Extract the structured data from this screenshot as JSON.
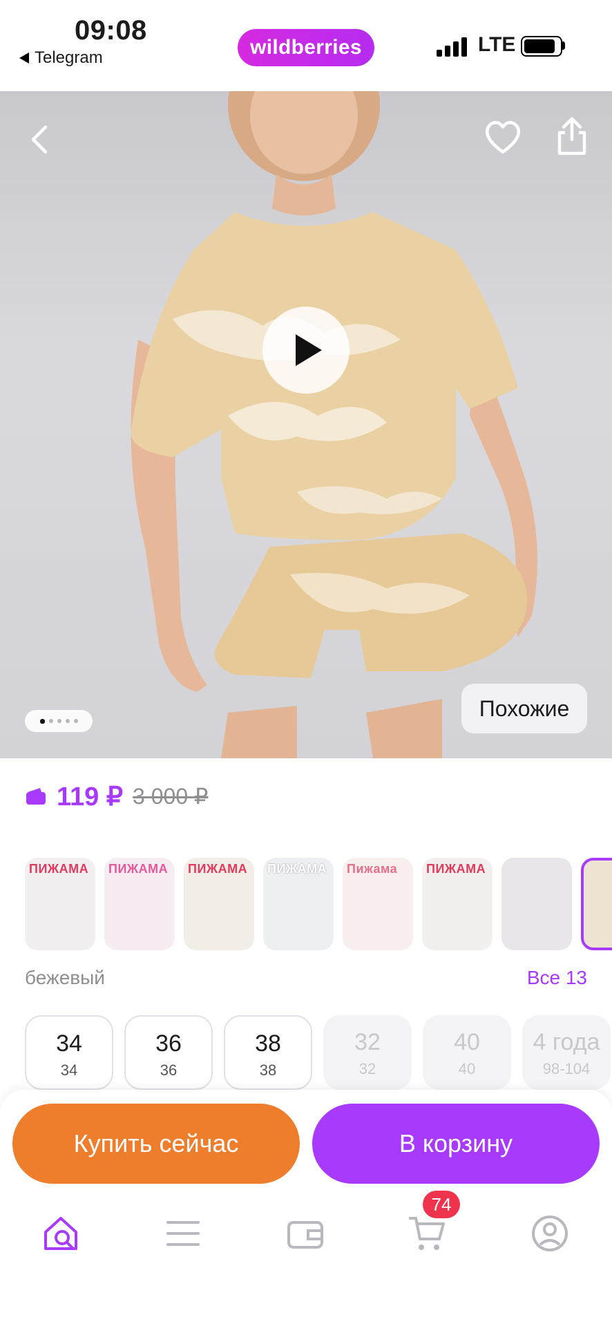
{
  "status_bar": {
    "time": "09:08",
    "back_app": "Telegram",
    "network": "LTE"
  },
  "header": {
    "logo": "wildberries",
    "icons": [
      "back-arrow-icon",
      "heart-icon",
      "share-icon"
    ]
  },
  "gallery": {
    "similar_label": "Похожие",
    "dot_count": 5,
    "active_dot": 1
  },
  "price": {
    "current": "119 ₽",
    "old": "3 000 ₽"
  },
  "color_variants": {
    "thumbnails": [
      {
        "label": "ПИЖАМА"
      },
      {
        "label": "ПИЖАМА"
      },
      {
        "label": "ПИЖАМА"
      },
      {
        "label": "ПИЖАМА"
      },
      {
        "label": "Пижама"
      },
      {
        "label": "ПИЖАМА"
      },
      {
        "label": ""
      },
      {
        "label": ""
      }
    ],
    "selected_name": "бежевый",
    "all_label": "Все 13"
  },
  "sizes": [
    {
      "size": "34",
      "sub": "34",
      "available": true
    },
    {
      "size": "36",
      "sub": "36",
      "available": true
    },
    {
      "size": "38",
      "sub": "38",
      "available": true
    },
    {
      "size": "32",
      "sub": "32",
      "available": false
    },
    {
      "size": "40",
      "sub": "40",
      "available": false
    },
    {
      "size": "4 года",
      "sub": "98-104",
      "available": false
    }
  ],
  "actions": {
    "buy_now": "Купить сейчас",
    "add_to_cart": "В корзину"
  },
  "tabbar": {
    "cart_badge": "74",
    "icons": [
      "home-search-icon",
      "menu-icon",
      "wallet-icon",
      "cart-icon",
      "profile-icon"
    ]
  },
  "colors": {
    "accent": "#a73afd",
    "buy": "#ee7d2c",
    "badge": "#f0334c",
    "logo_gradient_start": "#d52ae0",
    "logo_gradient_end": "#b62cf0"
  }
}
